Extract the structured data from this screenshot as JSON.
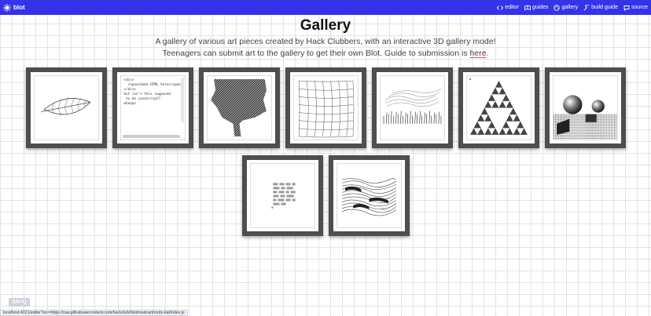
{
  "nav": {
    "brand": "blot",
    "links": [
      {
        "label": "editor",
        "icon": "code-icon"
      },
      {
        "label": "guides",
        "icon": "book-icon"
      },
      {
        "label": "gallery",
        "icon": "palette-icon"
      },
      {
        "label": "build guide",
        "icon": "wrench-icon"
      },
      {
        "label": "source",
        "icon": "chat-icon"
      }
    ]
  },
  "page": {
    "title": "Gallery",
    "line1": "A gallery of various art pieces created by Hack Clubbers, with an interactive 3D gallery mode!",
    "line2_prefix": "Teenagers can submit art to the gallery to get their own Blot. Guide to submission is ",
    "line2_link": "here",
    "line2_suffix": "."
  },
  "gallery": {
    "code_snippet": "<div>\n  <span>Some HTML here</span>\n</div>\nbut isn't this supposed\n to be javascript?\nwhoops"
  },
  "overlay": {
    "hint": "Alt+Q",
    "status_url": "localhost:4321/editor?src=https://raw.githubusercontent.com/hackclub/blot/main/art/roots-kai/index.js"
  },
  "colors": {
    "navbar": "#3433e8",
    "frame": "#4e4e4e",
    "link_underline": "#e0506a"
  }
}
